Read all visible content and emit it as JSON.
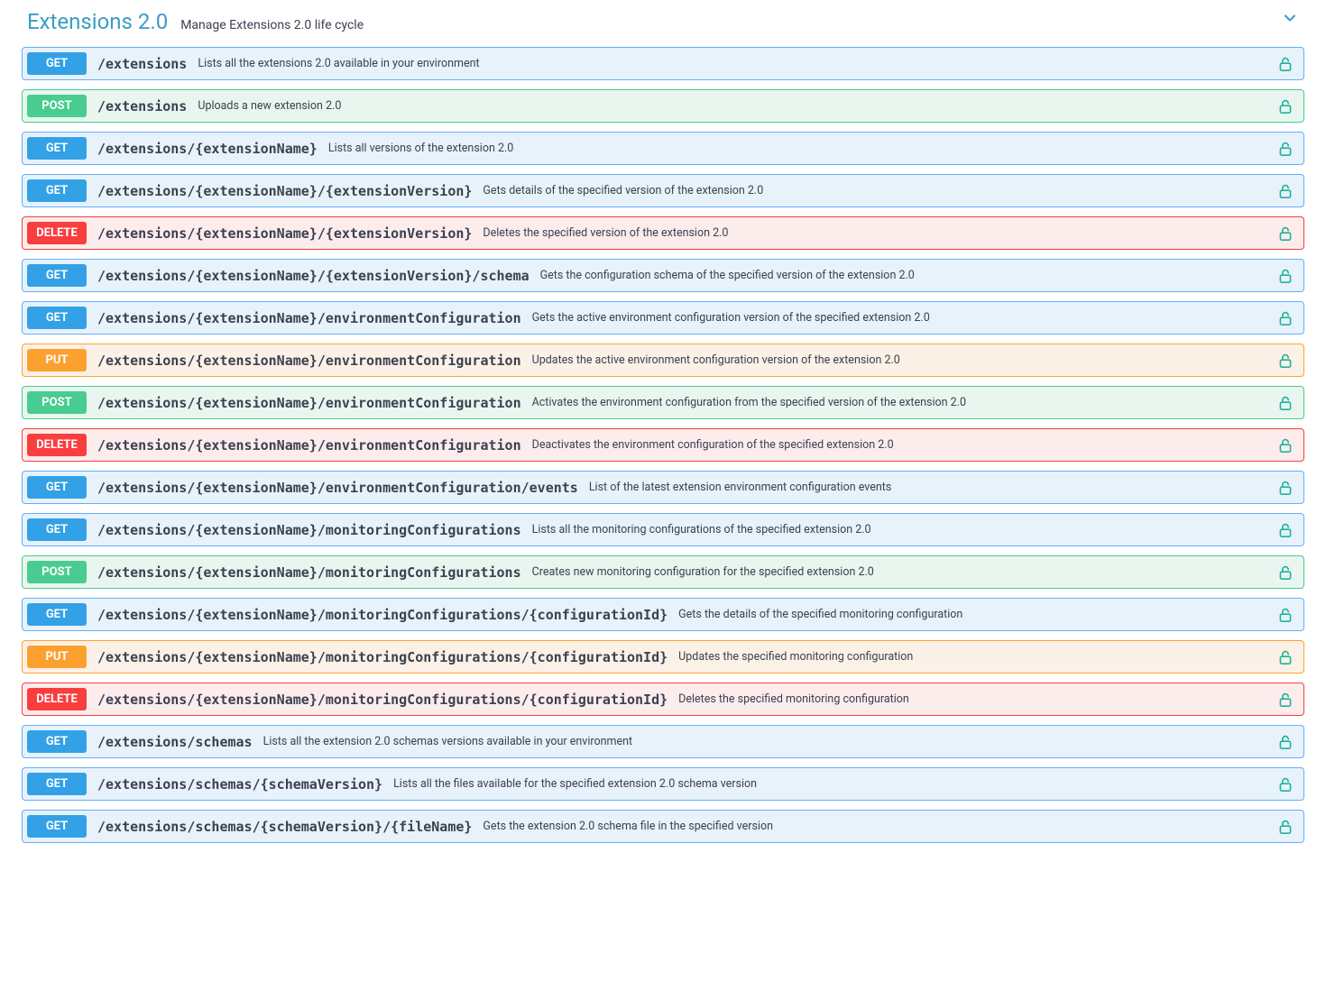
{
  "section": {
    "title": "Extensions 2.0",
    "description": "Manage Extensions 2.0 life cycle"
  },
  "operations": [
    {
      "method": "GET",
      "path": "/extensions",
      "summary": "Lists all the extensions 2.0 available in your environment"
    },
    {
      "method": "POST",
      "path": "/extensions",
      "summary": "Uploads a new extension 2.0"
    },
    {
      "method": "GET",
      "path": "/extensions/{extensionName}",
      "summary": "Lists all versions of the extension 2.0"
    },
    {
      "method": "GET",
      "path": "/extensions/{extensionName}/{extensionVersion}",
      "summary": "Gets details of the specified version of the extension 2.0"
    },
    {
      "method": "DELETE",
      "path": "/extensions/{extensionName}/{extensionVersion}",
      "summary": "Deletes the specified version of the extension 2.0"
    },
    {
      "method": "GET",
      "path": "/extensions/{extensionName}/{extensionVersion}/schema",
      "summary": "Gets the configuration schema of the specified version of the extension 2.0"
    },
    {
      "method": "GET",
      "path": "/extensions/{extensionName}/environmentConfiguration",
      "summary": "Gets the active environment configuration version of the specified extension 2.0"
    },
    {
      "method": "PUT",
      "path": "/extensions/{extensionName}/environmentConfiguration",
      "summary": "Updates the active environment configuration version of the extension 2.0"
    },
    {
      "method": "POST",
      "path": "/extensions/{extensionName}/environmentConfiguration",
      "summary": "Activates the environment configuration from the specified version of the extension 2.0"
    },
    {
      "method": "DELETE",
      "path": "/extensions/{extensionName}/environmentConfiguration",
      "summary": "Deactivates the environment configuration of the specified extension 2.0"
    },
    {
      "method": "GET",
      "path": "/extensions/{extensionName}/environmentConfiguration/events",
      "summary": "List of the latest extension environment configuration events"
    },
    {
      "method": "GET",
      "path": "/extensions/{extensionName}/monitoringConfigurations",
      "summary": "Lists all the monitoring configurations of the specified extension 2.0"
    },
    {
      "method": "POST",
      "path": "/extensions/{extensionName}/monitoringConfigurations",
      "summary": "Creates new monitoring configuration for the specified extension 2.0"
    },
    {
      "method": "GET",
      "path": "/extensions/{extensionName}/monitoringConfigurations/{configurationId}",
      "summary": "Gets the details of the specified monitoring configuration"
    },
    {
      "method": "PUT",
      "path": "/extensions/{extensionName}/monitoringConfigurations/{configurationId}",
      "summary": "Updates the specified monitoring configuration"
    },
    {
      "method": "DELETE",
      "path": "/extensions/{extensionName}/monitoringConfigurations/{configurationId}",
      "summary": "Deletes the specified monitoring configuration"
    },
    {
      "method": "GET",
      "path": "/extensions/schemas",
      "summary": "Lists all the extension 2.0 schemas versions available in your environment"
    },
    {
      "method": "GET",
      "path": "/extensions/schemas/{schemaVersion}",
      "summary": "Lists all the files available for the specified extension 2.0 schema version"
    },
    {
      "method": "GET",
      "path": "/extensions/schemas/{schemaVersion}/{fileName}",
      "summary": "Gets the extension 2.0 schema file in the specified version"
    }
  ]
}
